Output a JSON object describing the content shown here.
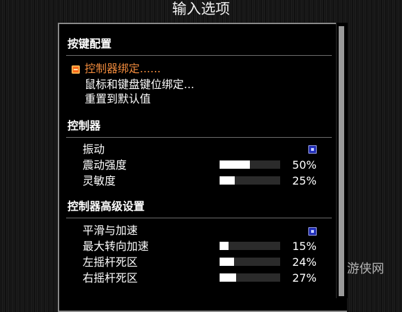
{
  "title": "输入选项",
  "sections": {
    "keybinds": {
      "header": "按键配置",
      "items": {
        "controller_binding": "控制器绑定......",
        "mouse_keyboard_binding": "鼠标和键盘键位绑定...",
        "reset_defaults": "重置到默认值"
      }
    },
    "controller": {
      "header": "控制器",
      "vibration": {
        "label": "振动",
        "checked": true
      },
      "vibration_strength": {
        "label": "震动强度",
        "value": "50%",
        "fraction": 0.5
      },
      "sensitivity": {
        "label": "灵敏度",
        "value": "25%",
        "fraction": 0.25
      }
    },
    "advanced": {
      "header": "控制器高级设置",
      "smoothing": {
        "label": "平滑与加速",
        "checked": true
      },
      "max_turn_accel": {
        "label": "最大转向加速",
        "value": "15%",
        "fraction": 0.15
      },
      "left_deadzone": {
        "label": "左摇杆死区",
        "value": "24%",
        "fraction": 0.24
      },
      "right_deadzone": {
        "label": "右摇杆死区",
        "value": "27%",
        "fraction": 0.27
      }
    }
  },
  "watermark": "游侠网",
  "colors": {
    "selected_text": "#f08a3c",
    "checkbox": "#2f3fd8",
    "slider_fill": "#ffffff"
  }
}
